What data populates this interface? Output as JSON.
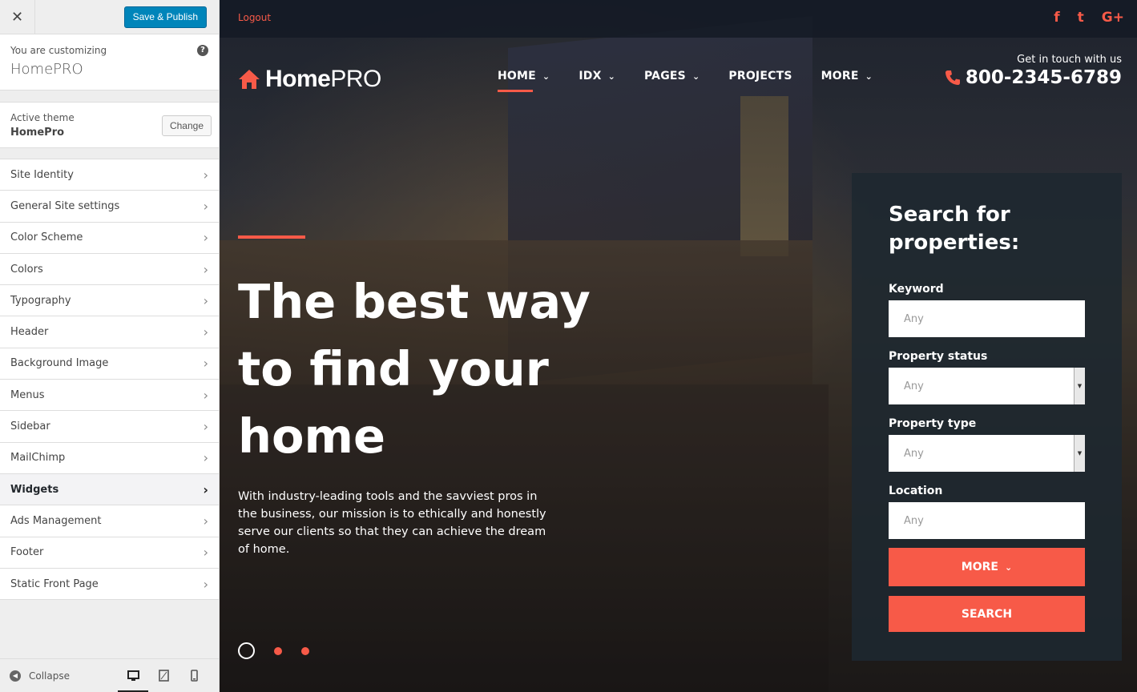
{
  "customizer": {
    "save_label": "Save & Publish",
    "you_are_customizing": "You are customizing",
    "site_name": "HomePRO",
    "active_theme_label": "Active theme",
    "active_theme_name": "HomePro",
    "change_label": "Change",
    "sections": [
      {
        "label": "Site Identity"
      },
      {
        "label": "General Site settings"
      },
      {
        "label": "Color Scheme"
      },
      {
        "label": "Colors"
      },
      {
        "label": "Typography"
      },
      {
        "label": "Header"
      },
      {
        "label": "Background Image"
      },
      {
        "label": "Menus"
      },
      {
        "label": "Sidebar"
      },
      {
        "label": "MailChimp"
      },
      {
        "label": "Widgets"
      },
      {
        "label": "Ads Management"
      },
      {
        "label": "Footer"
      },
      {
        "label": "Static Front Page"
      }
    ],
    "active_section": "Widgets",
    "collapse_label": "Collapse"
  },
  "site": {
    "logout": "Logout",
    "socials": [
      "facebook-icon",
      "twitter-icon",
      "google-plus-icon"
    ],
    "social_glyphs": [
      "f",
      "t",
      "G+"
    ],
    "logo_bold": "Home",
    "logo_light": "PRO",
    "nav": [
      {
        "label": "HOME",
        "dropdown": true,
        "active": true
      },
      {
        "label": "IDX",
        "dropdown": true
      },
      {
        "label": "PAGES",
        "dropdown": true
      },
      {
        "label": "PROJECTS",
        "dropdown": false
      },
      {
        "label": "MORE",
        "dropdown": true
      }
    ],
    "contact_label": "Get in touch with us",
    "phone": "800-2345-6789",
    "hero_title": "The best way to find your home",
    "hero_text": "With industry-leading tools and the savviest pros in the business, our mission is to ethically and honestly serve our clients so that they can achieve the dream of home.",
    "slider_dots": 3,
    "active_dot": 0
  },
  "search": {
    "title": "Search for properties:",
    "keyword_label": "Keyword",
    "keyword_placeholder": "Any",
    "status_label": "Property status",
    "status_value": "Any",
    "type_label": "Property type",
    "type_value": "Any",
    "location_label": "Location",
    "location_placeholder": "Any",
    "more_label": "MORE",
    "search_label": "SEARCH"
  },
  "colors": {
    "accent": "#f75a48",
    "wp_blue": "#0085ba"
  }
}
